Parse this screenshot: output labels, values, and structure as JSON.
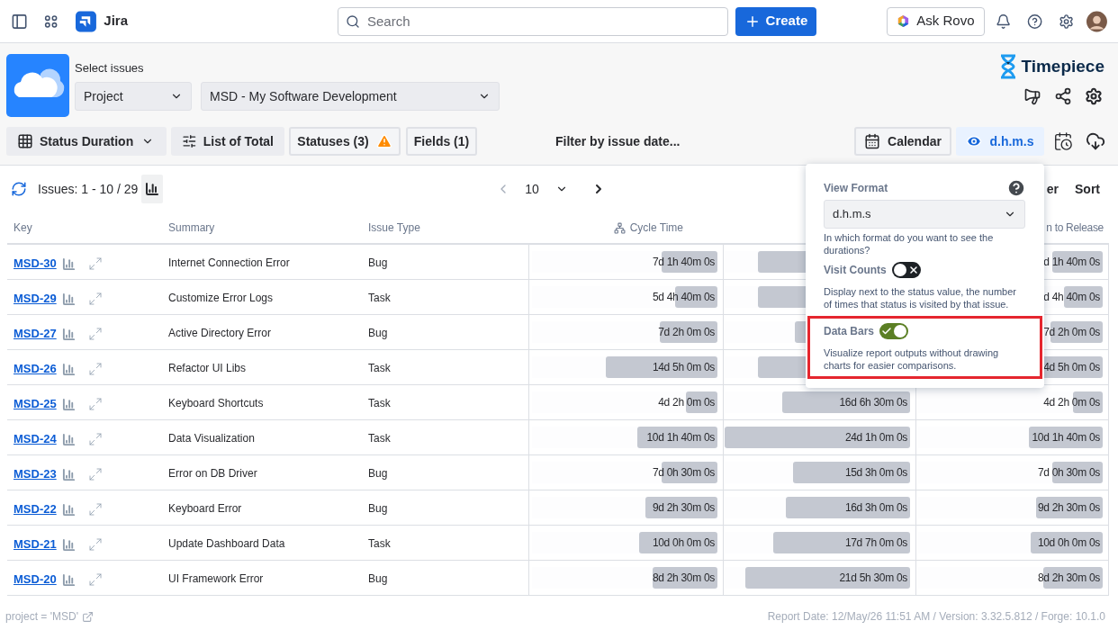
{
  "nav": {
    "product": "Jira",
    "search_placeholder": "Search",
    "create": "Create",
    "ask": "Ask Rovo"
  },
  "filters": {
    "label": "Select issues",
    "scope": "Project",
    "project": "MSD - My Software Development"
  },
  "brand": "Timepiece",
  "toolbar": {
    "report": "Status Duration",
    "list": "List of Total",
    "statuses": "Statuses (3)",
    "statuses_warning": true,
    "fields": "Fields (1)",
    "date_filter": "Filter by issue date...",
    "calendar": "Calendar",
    "format": "d.h.m.s",
    "format_selected": true
  },
  "results": {
    "count": "Issues: 1 - 10 / 29",
    "page_size": "10",
    "filter_cut": "er",
    "sort": "Sort"
  },
  "table": {
    "columns": [
      {
        "label": "Key",
        "kind": "text"
      },
      {
        "label": "Summary",
        "kind": "text"
      },
      {
        "label": "Issue Type",
        "kind": "text"
      },
      {
        "label": "Cycle Time",
        "kind": "workflow"
      },
      {
        "kind": "duration"
      },
      {
        "label": "n to Release",
        "kind": "duration"
      }
    ],
    "rows": [
      {
        "key": "MSD-30",
        "summary": "Internet Connection Error",
        "type": "Bug",
        "cells": [
          {
            "value": "7d 1h 40m 0s",
            "level": 0.3
          },
          {
            "level": 0.82
          },
          {
            "value": "d 1h 40m 0s",
            "level": 0.27
          }
        ]
      },
      {
        "key": "MSD-29",
        "summary": "Customize Error Logs",
        "type": "Task",
        "cells": [
          {
            "value": "5d 4h 40m 0s",
            "level": 0.23
          },
          {
            "level": 0.82
          },
          {
            "value": "d 4h 40m 0s",
            "level": 0.21
          }
        ]
      },
      {
        "key": "MSD-27",
        "summary": "Active Directory Error",
        "type": "Bug",
        "cells": [
          {
            "value": "7d 2h 0m 0s",
            "level": 0.31
          },
          {
            "level": 0.62
          },
          {
            "value": "7d 2h 0m 0s",
            "level": 0.28
          }
        ]
      },
      {
        "key": "MSD-26",
        "summary": "Refactor UI Libs",
        "type": "Task",
        "cells": [
          {
            "value": "14d 5h 0m 0s",
            "level": 0.6
          },
          {
            "level": 0.82
          },
          {
            "value": "4d 5h 0m 0s",
            "level": 0.55
          }
        ]
      },
      {
        "key": "MSD-25",
        "summary": "Keyboard Shortcuts",
        "type": "Task",
        "cells": [
          {
            "value": "4d 2h 0m 0s",
            "level": 0.17
          },
          {
            "value": "16d 6h 30m 0s",
            "level": 0.69
          },
          {
            "value": "4d 2h 0m 0s",
            "level": 0.16
          }
        ]
      },
      {
        "key": "MSD-24",
        "summary": "Data Visualization",
        "type": "Task",
        "cells": [
          {
            "value": "10d 1h 40m 0s",
            "level": 0.43
          },
          {
            "value": "24d 1h 0m 0s",
            "level": 1.0
          },
          {
            "value": "10d 1h 40m 0s",
            "level": 0.4
          }
        ]
      },
      {
        "key": "MSD-23",
        "summary": "Error on DB Driver",
        "type": "Bug",
        "cells": [
          {
            "value": "7d 0h 30m 0s",
            "level": 0.3
          },
          {
            "value": "15d 3h 0m 0s",
            "level": 0.63
          },
          {
            "value": "7d 0h 30m 0s",
            "level": 0.27
          }
        ]
      },
      {
        "key": "MSD-22",
        "summary": "Keyboard Error",
        "type": "Bug",
        "cells": [
          {
            "value": "9d 2h 30m 0s",
            "level": 0.39
          },
          {
            "value": "16d 3h 0m 0s",
            "level": 0.67
          },
          {
            "value": "9d 2h 30m 0s",
            "level": 0.36
          }
        ]
      },
      {
        "key": "MSD-21",
        "summary": "Update Dashboard Data",
        "type": "Task",
        "cells": [
          {
            "value": "10d 0h 0m 0s",
            "level": 0.42
          },
          {
            "value": "17d 7h 0m 0s",
            "level": 0.74
          },
          {
            "value": "10d 0h 0m 0s",
            "level": 0.39
          }
        ]
      },
      {
        "key": "MSD-20",
        "summary": "UI Framework Error",
        "type": "Bug",
        "cells": [
          {
            "value": "8d 2h 30m 0s",
            "level": 0.35
          },
          {
            "value": "21d 5h 30m 0s",
            "level": 0.89
          },
          {
            "value": "8d 2h 30m 0s",
            "level": 0.32
          }
        ]
      }
    ]
  },
  "popover": {
    "title": "View Format",
    "value": "d.h.m.s",
    "hint": "In which format do you want to see the durations?",
    "settings": [
      {
        "label": "Visit Counts",
        "on": false,
        "highlighted": false,
        "description": "Display next to the status value, the number of times that status is visited by that issue."
      },
      {
        "label": "Data Bars",
        "on": true,
        "highlighted": true,
        "description": "Visualize report outputs without drawing charts for easier comparisons."
      }
    ]
  },
  "footer": {
    "query": "project = 'MSD'",
    "meta": "Report Date: 12/May/26 11:51 AM / Version: 3.32.5.812 / Forge: 10.1.0"
  }
}
